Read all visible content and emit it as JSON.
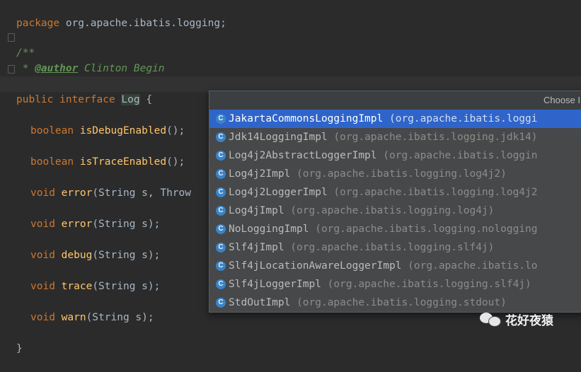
{
  "code": {
    "package_kw": "package",
    "package_name": " org.apache.ibatis.logging;",
    "doc_open": "/**",
    "doc_author_prefix": " * ",
    "doc_author_tag": "@author",
    "doc_author_name": " Clinton Begin",
    "doc_close": " */",
    "decl_kw": "public interface",
    "decl_space": " ",
    "decl_name": "Log",
    "decl_brace": " {",
    "methods": [
      {
        "ret": "boolean",
        "name": "isDebugEnabled",
        "rest": "();"
      },
      {
        "ret": "boolean",
        "name": "isTraceEnabled",
        "rest": "();"
      },
      {
        "ret": "void",
        "name": "error",
        "rest": "(String s, Throw"
      },
      {
        "ret": "void",
        "name": "error",
        "rest": "(String s);"
      },
      {
        "ret": "void",
        "name": "debug",
        "rest": "(String s);"
      },
      {
        "ret": "void",
        "name": "trace",
        "rest": "(String s);"
      },
      {
        "ret": "void",
        "name": "warn",
        "rest": "(String s);"
      }
    ],
    "closing_brace": "}"
  },
  "popup": {
    "title": "Choose I",
    "icon_letter": "C",
    "items": [
      {
        "name": "JakartaCommonsLoggingImpl",
        "pkg": " (org.apache.ibatis.loggi"
      },
      {
        "name": "Jdk14LoggingImpl",
        "pkg": " (org.apache.ibatis.logging.jdk14)"
      },
      {
        "name": "Log4j2AbstractLoggerImpl",
        "pkg": " (org.apache.ibatis.loggin"
      },
      {
        "name": "Log4j2Impl",
        "pkg": " (org.apache.ibatis.logging.log4j2)"
      },
      {
        "name": "Log4j2LoggerImpl",
        "pkg": " (org.apache.ibatis.logging.log4j2"
      },
      {
        "name": "Log4jImpl",
        "pkg": " (org.apache.ibatis.logging.log4j)"
      },
      {
        "name": "NoLoggingImpl",
        "pkg": " (org.apache.ibatis.logging.nologging"
      },
      {
        "name": "Slf4jImpl",
        "pkg": " (org.apache.ibatis.logging.slf4j)"
      },
      {
        "name": "Slf4jLocationAwareLoggerImpl",
        "pkg": " (org.apache.ibatis.lo"
      },
      {
        "name": "Slf4jLoggerImpl",
        "pkg": " (org.apache.ibatis.logging.slf4j)"
      },
      {
        "name": "StdOutImpl",
        "pkg": " (org.apache.ibatis.logging.stdout)"
      }
    ],
    "selected_index": 0
  },
  "watermark": {
    "text": "花好夜猿"
  },
  "colors": {
    "background": "#2b2b2b",
    "keyword": "#cc7832",
    "method": "#ffc66d",
    "doc_comment": "#629755",
    "selection": "#2f65ca"
  }
}
